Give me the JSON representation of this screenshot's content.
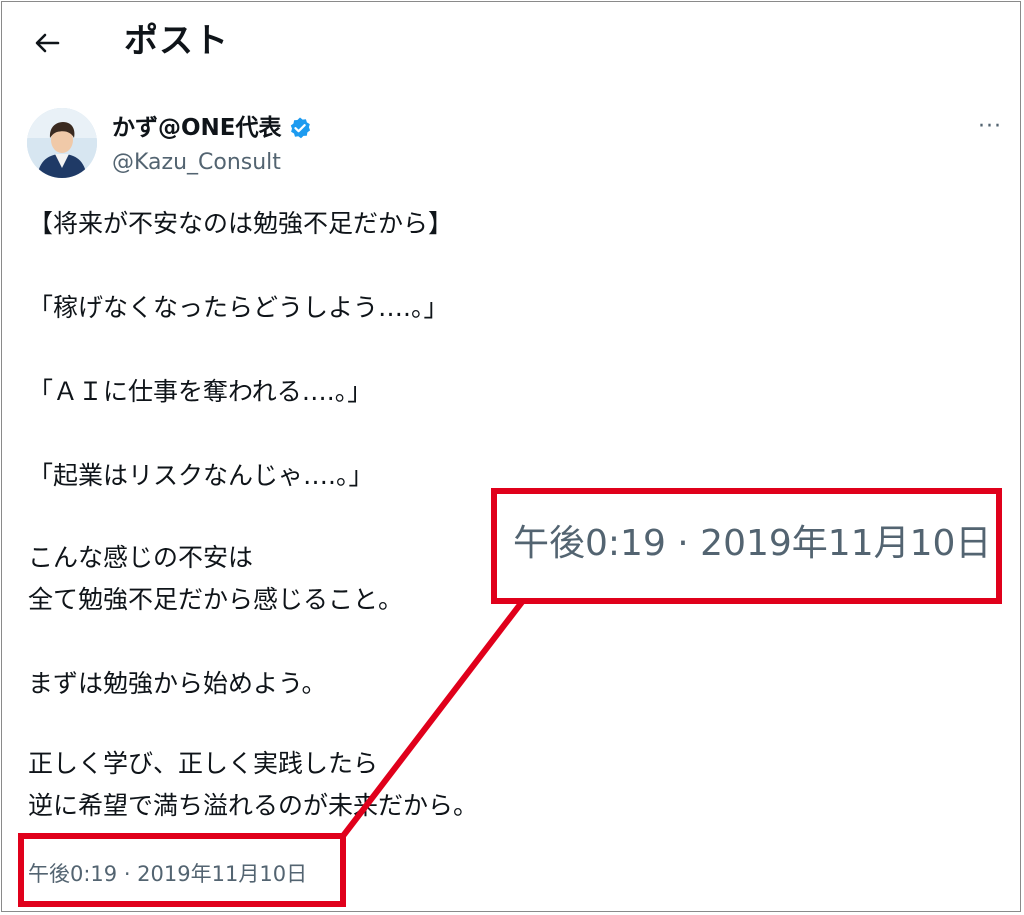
{
  "header": {
    "back_icon": "arrow-left-icon",
    "title": "ポスト"
  },
  "author": {
    "avatar_icon": "avatar",
    "display_name": "かず@ONE代表",
    "verified_icon": "verified-badge-icon",
    "handle": "@Kazu_Consult",
    "more_icon": "more-dots-icon",
    "more_label": "···"
  },
  "tweet": {
    "lines": [
      "【将来が不安なのは勉強不足だから】",
      "「稼げなくなったらどうしよう….。」",
      "「ＡＩに仕事を奪われる….。」",
      "「起業はリスクなんじゃ….。」",
      "こんな感じの不安は",
      "全て勉強不足だから感じること。",
      "まずは勉強から始めよう。",
      "正しく学び、正しく実践したら",
      "逆に希望で満ち溢れるのが未来だから。"
    ],
    "timestamp": "午後0:19 · 2019年11月10日"
  },
  "callout": {
    "timestamp_enlarged": "午後0:19 · 2019年11月10日",
    "highlight_color": "#e0001b"
  },
  "colors": {
    "text_primary": "#0f1419",
    "text_secondary": "#536471",
    "verified_blue": "#1d9bf0",
    "highlight_red": "#e0001b"
  }
}
